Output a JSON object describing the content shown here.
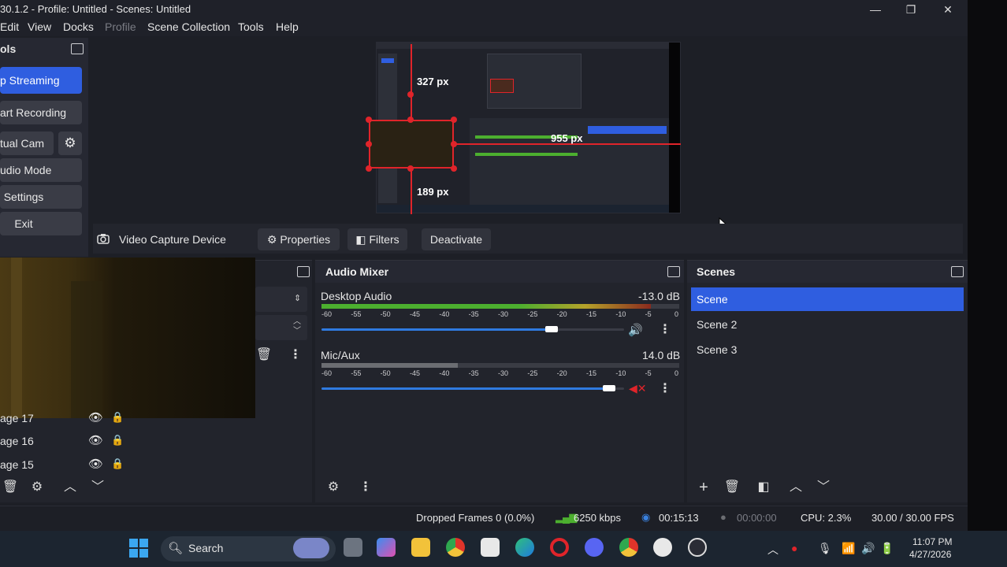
{
  "window": {
    "title": "30.1.2 - Profile: Untitled - Scenes: Untitled",
    "minimize": "—",
    "maximize": "❐",
    "close": "✕"
  },
  "menu": [
    "Edit",
    "View",
    "Docks",
    "Profile",
    "Scene Collection",
    "Tools",
    "Help"
  ],
  "controls": {
    "title": "ols",
    "stop_streaming": "p Streaming",
    "start_recording": "art Recording",
    "virtual_cam": "tual Cam",
    "studio_mode": "udio Mode",
    "settings": "Settings",
    "exit": "Exit"
  },
  "preview": {
    "label_top": "327 px",
    "label_right": "955 px",
    "label_bottom": "189 px"
  },
  "source_toolbar": {
    "source_name": "Video Capture Device",
    "properties": "Properties",
    "filters": "Filters",
    "deactivate": "Deactivate"
  },
  "sources": {
    "items": [
      "age 17",
      "age 16",
      "age 15"
    ]
  },
  "audio_mixer": {
    "title": "Audio Mixer",
    "ticks": [
      "-60",
      "-55",
      "-50",
      "-45",
      "-40",
      "-35",
      "-30",
      "-25",
      "-20",
      "-15",
      "-10",
      "-5",
      "0"
    ],
    "channels": [
      {
        "name": "Desktop Audio",
        "db": "-13.0 dB",
        "volume": 0.76,
        "level": 0.92
      },
      {
        "name": "Mic/Aux",
        "db": "14.0 dB",
        "volume": 0.95,
        "level": 0.38
      }
    ]
  },
  "scenes": {
    "title": "Scenes",
    "items": [
      "Scene",
      "Scene 2",
      "Scene 3"
    ],
    "selected": 0
  },
  "status": {
    "dropped_frames": "Dropped Frames 0 (0.0%)",
    "bitrate": "6250 kbps",
    "stream_time": "00:15:13",
    "rec_time": "00:00:00",
    "cpu": "CPU: 2.3%",
    "fps": "30.00 / 30.00 FPS"
  },
  "taskbar": {
    "search": "Search",
    "time": "11:07 PM",
    "date": "4/27/2026"
  },
  "colors": {
    "accent": "#2f5ee0",
    "danger": "#e0242a",
    "meter_green": "#4caf2f",
    "meter_yellow": "#b5a22a"
  }
}
